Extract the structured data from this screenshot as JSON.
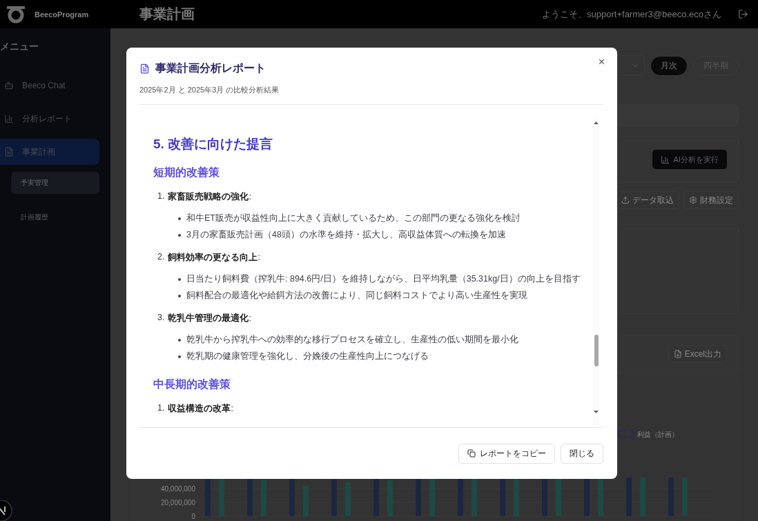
{
  "header": {
    "app_name": "BeecoProgram",
    "page_title": "事業計画",
    "welcome": "ようこそ、support+farmer3@beeco.ecoさん"
  },
  "sidebar": {
    "heading": "メニュー",
    "items": [
      {
        "label": "Beeco Chat",
        "selected": false
      },
      {
        "label": "分析レポート",
        "selected": false
      },
      {
        "label": "事業計画",
        "selected": true,
        "children": [
          {
            "label": "予実管理",
            "selected": true
          },
          {
            "label": "計画履歴",
            "selected": false
          }
        ]
      }
    ]
  },
  "background": {
    "period_tabs": [
      {
        "label": "月次",
        "selected": true
      },
      {
        "label": "四半期",
        "selected": false
      }
    ],
    "ai_button": "AI分析を実行",
    "import_button": "データ取込",
    "settings_button": "財務設定",
    "excel_button": "Excel出力",
    "chart": {
      "legend": "利益（計画）",
      "axis_labels": [
        "40,000,000",
        "20,000,000",
        "0"
      ]
    }
  },
  "modal": {
    "title": "事業計画分析レポート",
    "subtitle": "2025年2月 と 2025年3月 の比較分析結果",
    "close": "×",
    "content": [
      {
        "kind": "heading",
        "text": "5. 改善に向けた提言"
      },
      {
        "kind": "subheading",
        "text": "短期的改善策"
      },
      {
        "kind": "item",
        "number": "1.",
        "text": "**家畜販売戦略の強化**:",
        "bullets": [
          "和牛ET販売が収益性向上に大きく貢献しているため、この部門の更なる強化を検討",
          "3月の家畜販売計画（48頭）の水準を維持・拡大し、高収益体質への転換を加速"
        ]
      },
      {
        "kind": "item",
        "number": "2.",
        "text": "**飼料効率の更なる向上**:",
        "bullets": [
          "日当たり飼料費（搾乳牛: 894.6円/日）を維持しながら、日平均乳量（35.31kg/日）の向上を目指す",
          "飼料配合の最適化や給餌方法の改善により、同じ飼料コストでより高い生産性を実現"
        ]
      },
      {
        "kind": "item",
        "number": "3.",
        "text": "**乾乳牛管理の最適化**:",
        "bullets": [
          "乾乳牛から搾乳牛への効率的な移行プロセスを確立し、生産性の低い期間を最小化",
          "乾乳期の健康管理を強化し、分娩後の生産性向上につなげる"
        ]
      },
      {
        "kind": "subheading",
        "text": "中長期的改善策"
      },
      {
        "kind": "item",
        "number": "1.",
        "text": "**収益構造の改革**:"
      }
    ],
    "buttons": [
      "レポートをコピー",
      "閉じる"
    ]
  }
}
